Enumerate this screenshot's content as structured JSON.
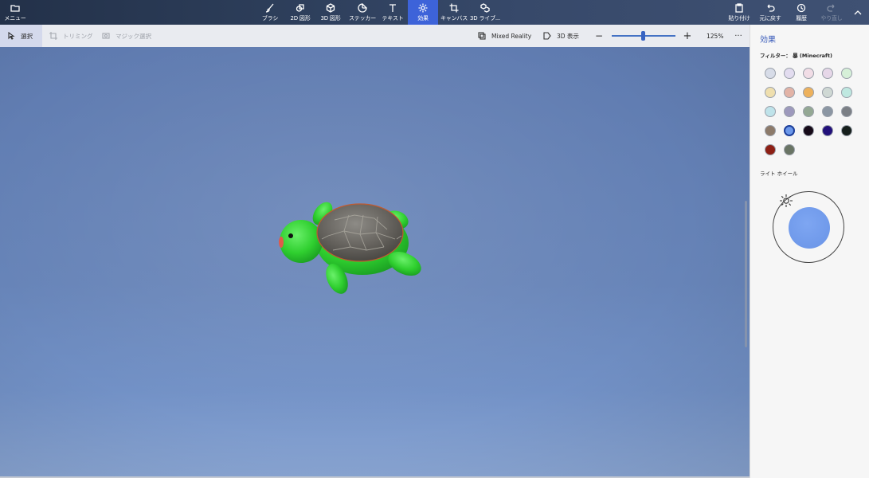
{
  "toolbar": {
    "menu": "メニュー",
    "brush": "ブラシ",
    "shapes2d": "2D 図形",
    "shapes3d": "3D 図形",
    "stickers": "ステッカー",
    "text": "テキスト",
    "effects": "効果",
    "canvas": "キャンバス",
    "library3d": "3D ライブ...",
    "paste": "貼り付け",
    "undo": "元に戻す",
    "history": "履歴",
    "redo": "やり直し"
  },
  "subbar": {
    "select": "選択",
    "crop": "トリミング",
    "magic_select": "マジック選択",
    "mixed_reality": "Mixed Reality",
    "view3d": "3D 表示",
    "zoom": "125%"
  },
  "panel": {
    "title": "効果",
    "filter_label": "フィルター： 暴 (Minecraft)",
    "light_wheel_label": "ライト ホイール",
    "swatches": [
      "#d7dce8",
      "#e2dcef",
      "#f1dde6",
      "#e6d7e8",
      "#d6f0d8",
      "#efdfae",
      "#e2b3a6",
      "#edb15c",
      "#cfd8d4",
      "#bfe8e0",
      "#bfe3ea",
      "#9d99bc",
      "#94a894",
      "#8b96a3",
      "#7b7f85",
      "#8c7a6a",
      "#6c98ea",
      "#160a18",
      "#22107a",
      "#161f1c",
      "#8d1f14",
      "#697464"
    ],
    "selected_swatch": 16
  }
}
